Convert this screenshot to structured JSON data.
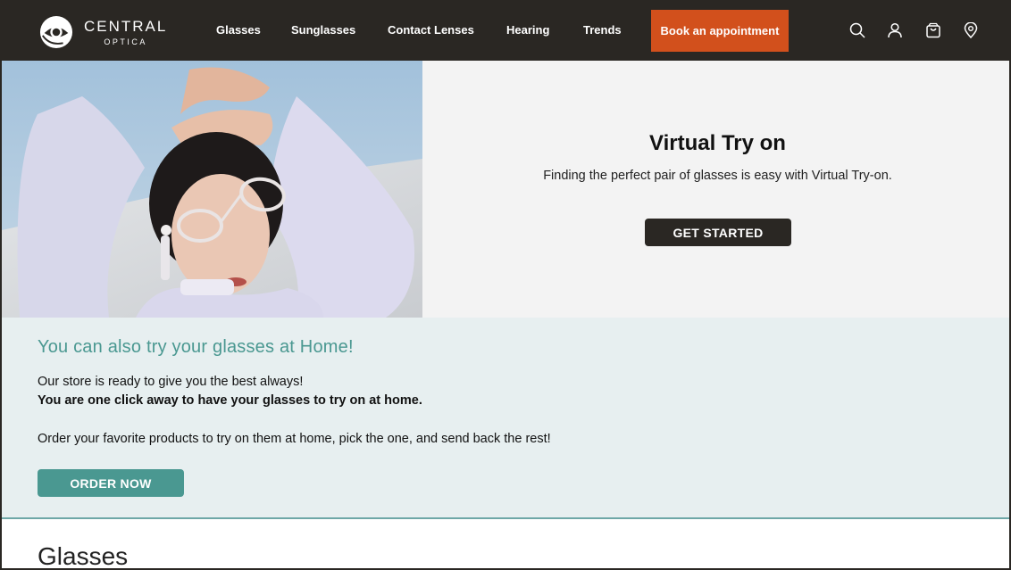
{
  "brand": {
    "name_line1": "CENTRAL",
    "name_line2": "OPTICA"
  },
  "nav": {
    "items": [
      {
        "label": "Glasses"
      },
      {
        "label": "Sunglasses"
      },
      {
        "label": "Contact Lenses"
      },
      {
        "label": "Hearing"
      },
      {
        "label": "Trends"
      }
    ],
    "cta_label": "Book an appointment",
    "icons": [
      "search-icon",
      "user-icon",
      "cart-icon",
      "location-pin-icon"
    ]
  },
  "hero": {
    "title": "Virtual Try on",
    "subtitle": "Finding the perfect pair of glasses is easy with Virtual Try-on.",
    "button_label": "GET STARTED"
  },
  "home_try": {
    "title": "You can also try your glasses at Home!",
    "line1": "Our store is ready to give you the best always!",
    "line2": "You are one click away to have your glasses to try on at home.",
    "line3": "Order your favorite products to try on them at home, pick the one, and send back the rest!",
    "button_label": "ORDER NOW"
  },
  "section": {
    "heading": "Glasses"
  },
  "colors": {
    "header_bg": "#2a2723",
    "accent_orange": "#d2501c",
    "teal": "#4a9891",
    "hero_panel_bg": "#f3f3f3",
    "home_bg": "#e7eff0"
  }
}
